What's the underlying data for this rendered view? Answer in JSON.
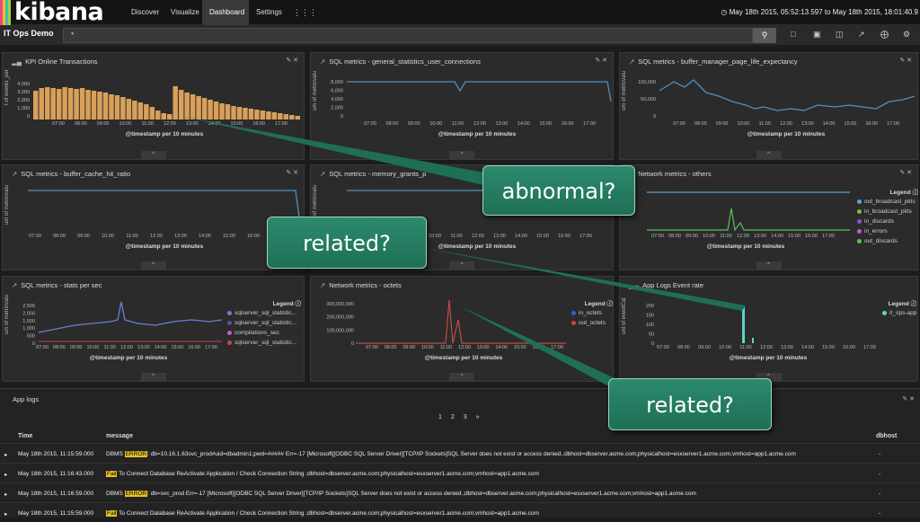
{
  "app": {
    "logo": "kibana",
    "colors": {
      "accent_bar": "#d9a05b",
      "grid": "#3a3a3a",
      "line_blue": "#4d8fc4",
      "callout": "#2a8467"
    }
  },
  "nav": {
    "tabs": [
      "Discover",
      "Visualize",
      "Dashboard",
      "Settings"
    ],
    "apps_icon": "grid-icon",
    "active": "Dashboard"
  },
  "timepicker": {
    "range": "May 18th 2015, 05:52:13.597 to May 18th 2015, 18:01:40.9"
  },
  "dashboard": {
    "title": "IT Ops Demo",
    "query": "*",
    "toolbar_icons": [
      "new-icon",
      "save-icon",
      "open-icon",
      "share-icon",
      "add-icon",
      "settings-icon"
    ]
  },
  "x_ticks": [
    "07:00",
    "08:00",
    "09:00",
    "10:00",
    "11:00",
    "12:00",
    "13:00",
    "14:00",
    "15:00",
    "16:00",
    "17:00"
  ],
  "x_ticks_compact": [
    "07:00",
    "08:00",
    "09:00",
    "10:00",
    "11:00",
    "12:00",
    "13:00",
    "14:00",
    "15:00",
    "16:00",
    "17:00"
  ],
  "x_label": "@timestamp per 10 minutes",
  "panels": {
    "kpi": {
      "title": "KPI Online Transactions",
      "ylabel": "t of events_per",
      "yticks": [
        "4,000",
        "3,000",
        "2,000",
        "1,000",
        "0"
      ]
    },
    "conn": {
      "title": "SQL metrics - general_statistics_user_connections",
      "ylabel": "um of metricvalu",
      "yticks": [
        "8,000",
        "6,000",
        "4,000",
        "2,000",
        "0"
      ]
    },
    "buffer": {
      "title": "SQL metrics - buffer_manager_page_life_expectancy",
      "ylabel": "um of metricvalu",
      "yticks": [
        "100,000",
        "50,000",
        "0"
      ]
    },
    "cache": {
      "title": "SQL metrics - buffer_cache_hit_ratio",
      "ylabel": "um of metricvalu"
    },
    "memory": {
      "title": "SQL metrics - memory_grants_p",
      "ylabel": "um of metricvalu"
    },
    "netothers": {
      "title": "Network metrics - others",
      "legend_title": "Legend",
      "legend": [
        "out_broadcast_pkts",
        "in_broadcast_pkts",
        "in_discards",
        "in_errors",
        "out_discards"
      ],
      "legend_colors": [
        "#5aa7d6",
        "#7bbf3f",
        "#7b5ad6",
        "#c45ad6",
        "#5abf5a"
      ]
    },
    "stats": {
      "title": "SQL metrics - stats per sec",
      "ylabel": "um of metricvalu",
      "yticks": [
        "2,500",
        "2,000",
        "1,500",
        "1,000",
        "500",
        "0"
      ],
      "legend_title": "Legend",
      "legend": [
        "sqlserver_sql_statistic...",
        "sqlserver_sql_statistic...",
        "compilations_sec",
        "sqlserver_sql_statistic..."
      ],
      "legend_colors": [
        "#6b7ed6",
        "#5a4bb0",
        "#c45ad6",
        "#c44a4a"
      ]
    },
    "octets": {
      "title": "Network metrics - octets",
      "yticks": [
        "300,000,000",
        "200,000,000",
        "100,000,000",
        "0"
      ],
      "legend_title": "Legend",
      "legend": [
        "in_octets",
        "out_octets"
      ],
      "legend_colors": [
        "#3a5ad6",
        "#c44a4a"
      ]
    },
    "applogsrate": {
      "title": "App Logs Event rate",
      "ylabel": "unt of eventCat",
      "yticks": [
        "200",
        "150",
        "100",
        "50",
        "0"
      ],
      "legend_title": "Legend",
      "legend": [
        "it_ops-app"
      ],
      "legend_colors": [
        "#5ad6c8"
      ]
    }
  },
  "applogs": {
    "title": "App logs",
    "pages": [
      "1",
      "2",
      "3",
      "»"
    ],
    "columns": {
      "time": "Time",
      "message": "message",
      "dbhost": "dbhost"
    },
    "rows": [
      {
        "time": "May 18th 2015, 11:15:59.000",
        "pre": "DBMS ",
        "tag": "ERROR",
        "msg": ": db=10.16.1.63svc_prod#uid=dbadmin1;pwd=##### Err=-17 [Microsoft][ODBC SQL Server Driver][TCP/IP Sockets]SQL Server does not exist or access denied.;dbhost=dbserver.acme.com;physicalhost=esxserver1.acme.com;vmhost=app1.acme.com",
        "dbhost": "-"
      },
      {
        "time": "May 18th 2015, 11:16:43.000",
        "pre": "",
        "tag": "Fail",
        "msg": " To Connect Database   ReActivate Application / Check Connection String ;dbhost=dbserver.acme.com;physicalhost=esxserver1.acme.com;vmhost=app1.acme.com",
        "dbhost": "-"
      },
      {
        "time": "May 18th 2015, 11:16:59.000",
        "pre": "DBMS ",
        "tag": "ERROR",
        "msg": ": db=svc_prod Err=-17 [Microsoft][ODBC SQL Server Driver][TCP/IP Sockets]SQL Server does not exist or access denied.;dbhost=dbserver.acme.com;physicalhost=esxserver1.acme.com;vmhost=app1.acme.com",
        "dbhost": "-"
      },
      {
        "time": "May 18th 2015, 11:15:59.000",
        "pre": "",
        "tag": "Fail",
        "msg": " To Connect Database   ReActivate Application / Check Connection String ;dbhost=dbserver.acme.com;physicalhost=esxserver1.acme.com;vmhost=app1.acme.com",
        "dbhost": "-"
      }
    ]
  },
  "callouts": {
    "abnormal": "abnormal?",
    "related1": "related?",
    "related2": "related?"
  }
}
